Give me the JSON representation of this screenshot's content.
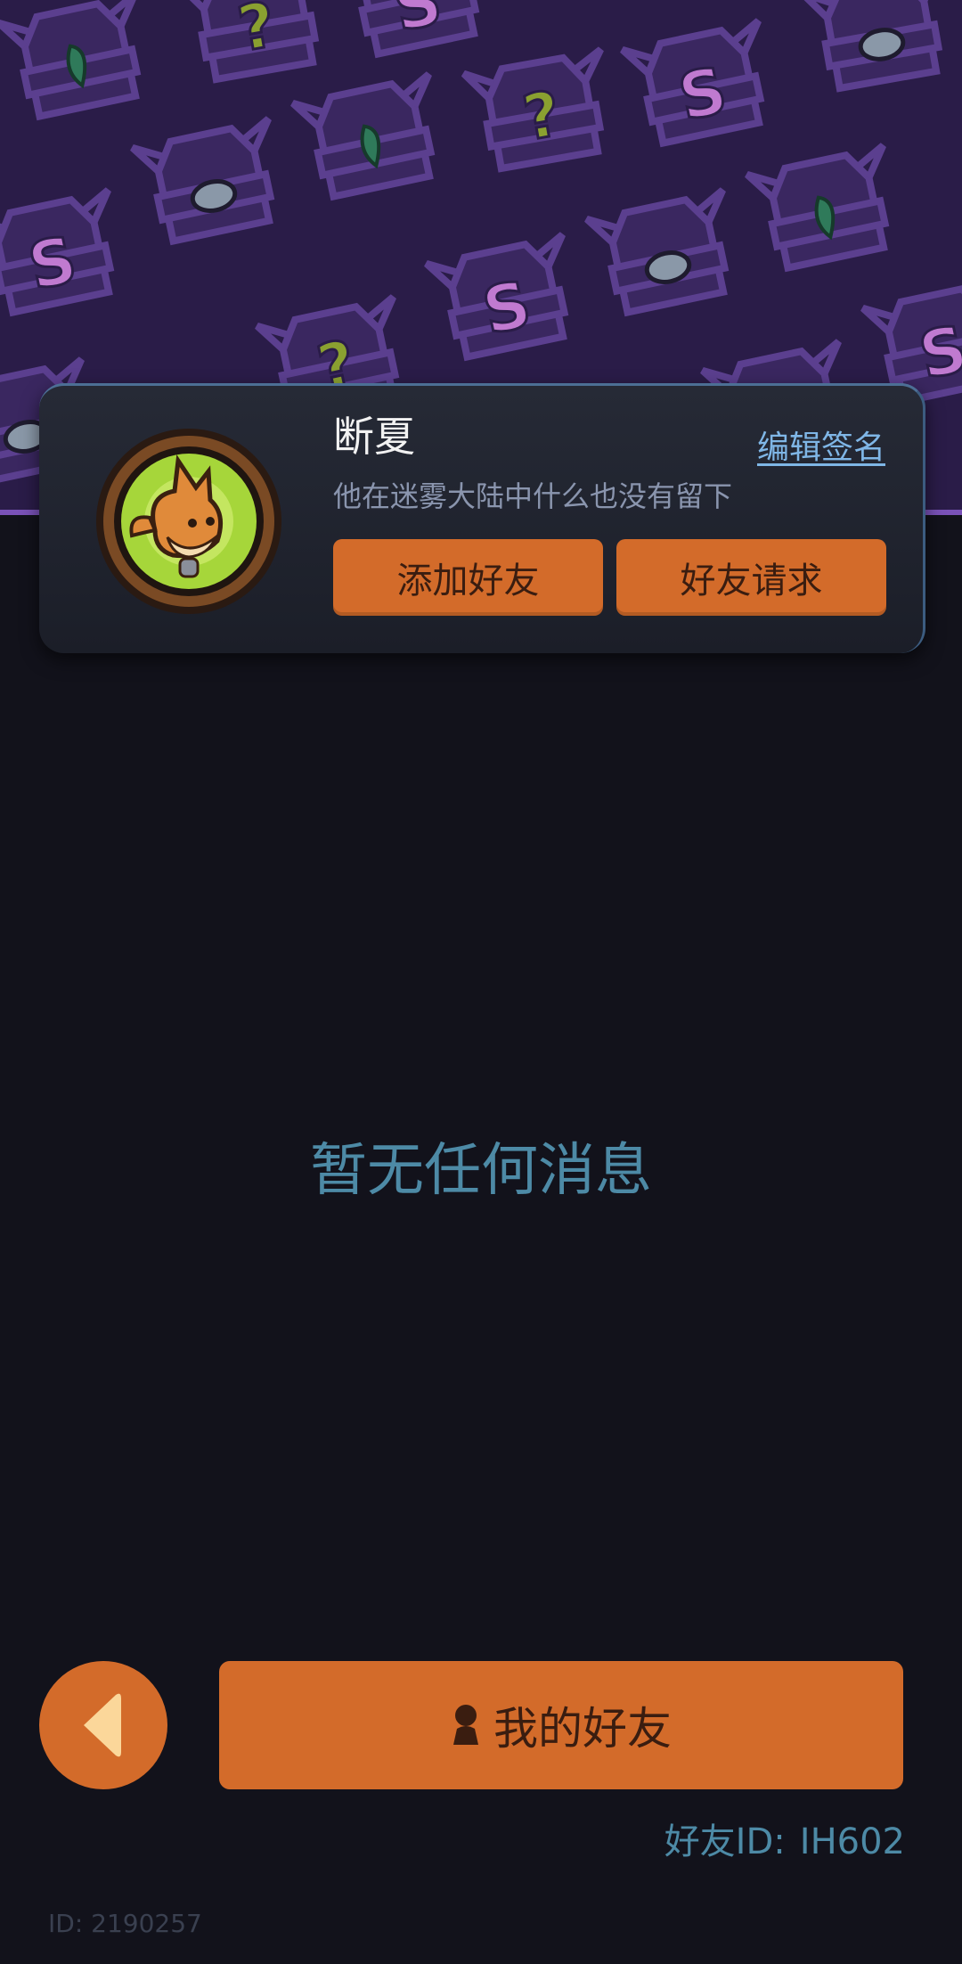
{
  "colors": {
    "accent_orange": "#d36b2a",
    "banner_purple": "#2a1c48",
    "background": "#12121b",
    "link_blue": "#7fb6e6",
    "muted_teal": "#4d8aa6"
  },
  "banner": {
    "pattern_icons": [
      "treasure-chest-icon",
      "question-mark-icon",
      "s-letter-icon",
      "leaf-icon",
      "gem-icon"
    ]
  },
  "profile": {
    "avatar_icon": "fox-avatar-icon",
    "username": "断夏",
    "edit_signature_label": "编辑签名",
    "signature": "他在迷雾大陆中什么也没有留下",
    "add_friend_label": "添加好友",
    "friend_requests_label": "好友请求"
  },
  "main": {
    "empty_message": "暂无任何消息"
  },
  "footer": {
    "back_icon": "back-arrow-icon",
    "my_friends_icon": "person-icon",
    "my_friends_label": "我的好友",
    "friend_id_label": "好友ID:",
    "friend_id_value": "IH602",
    "user_id_text": "ID: 2190257"
  }
}
